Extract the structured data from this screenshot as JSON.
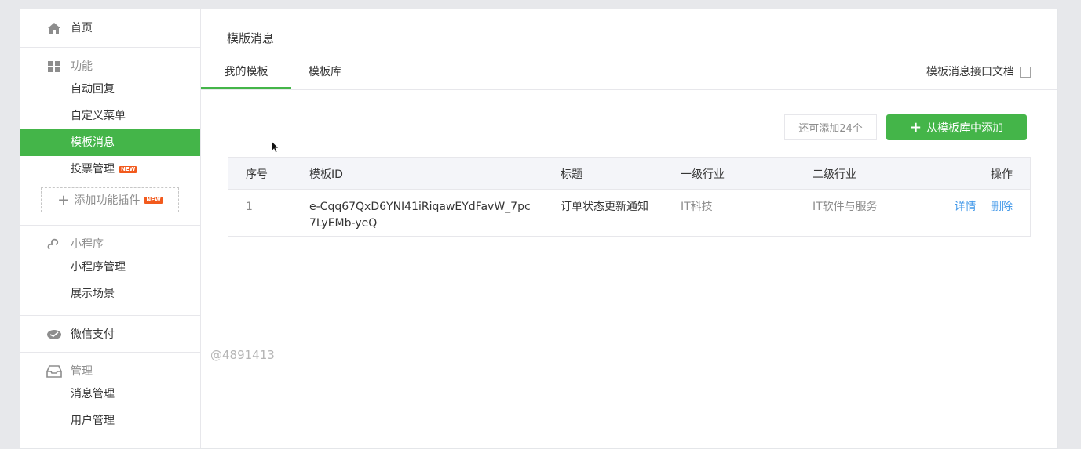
{
  "sidebar": {
    "home": "首页",
    "groups": [
      {
        "title": "功能",
        "items": [
          "自动回复",
          "自定义菜单",
          "模板消息",
          "投票管理"
        ]
      },
      {
        "title": "小程序",
        "items": [
          "小程序管理",
          "展示场景"
        ]
      },
      {
        "title": "微信支付",
        "items": []
      },
      {
        "title": "管理",
        "items": [
          "消息管理",
          "用户管理"
        ]
      }
    ],
    "new_badge": "NEW",
    "add_plugin": "添加功能插件"
  },
  "main": {
    "title": "模版消息",
    "tabs": [
      "我的模板",
      "模板库"
    ],
    "doc_link": "模板消息接口文档",
    "quota": "还可添加24个",
    "add_button": "从模板库中添加",
    "table": {
      "headers": [
        "序号",
        "模板ID",
        "标题",
        "一级行业",
        "二级行业",
        "操作"
      ],
      "rows": [
        {
          "index": "1",
          "template_id": "e-Cqq67QxD6YNI41iRiqawEYdFavW_7pc7LyEMb-yeQ",
          "title": "订单状态更新通知",
          "industry1": "IT科技",
          "industry2": "IT软件与服务",
          "op_detail": "详情",
          "op_delete": "删除"
        }
      ]
    },
    "watermark": "@4891413"
  },
  "colors": {
    "accent": "#44b549",
    "link": "#459ae9",
    "badge": "#f25a1d"
  }
}
